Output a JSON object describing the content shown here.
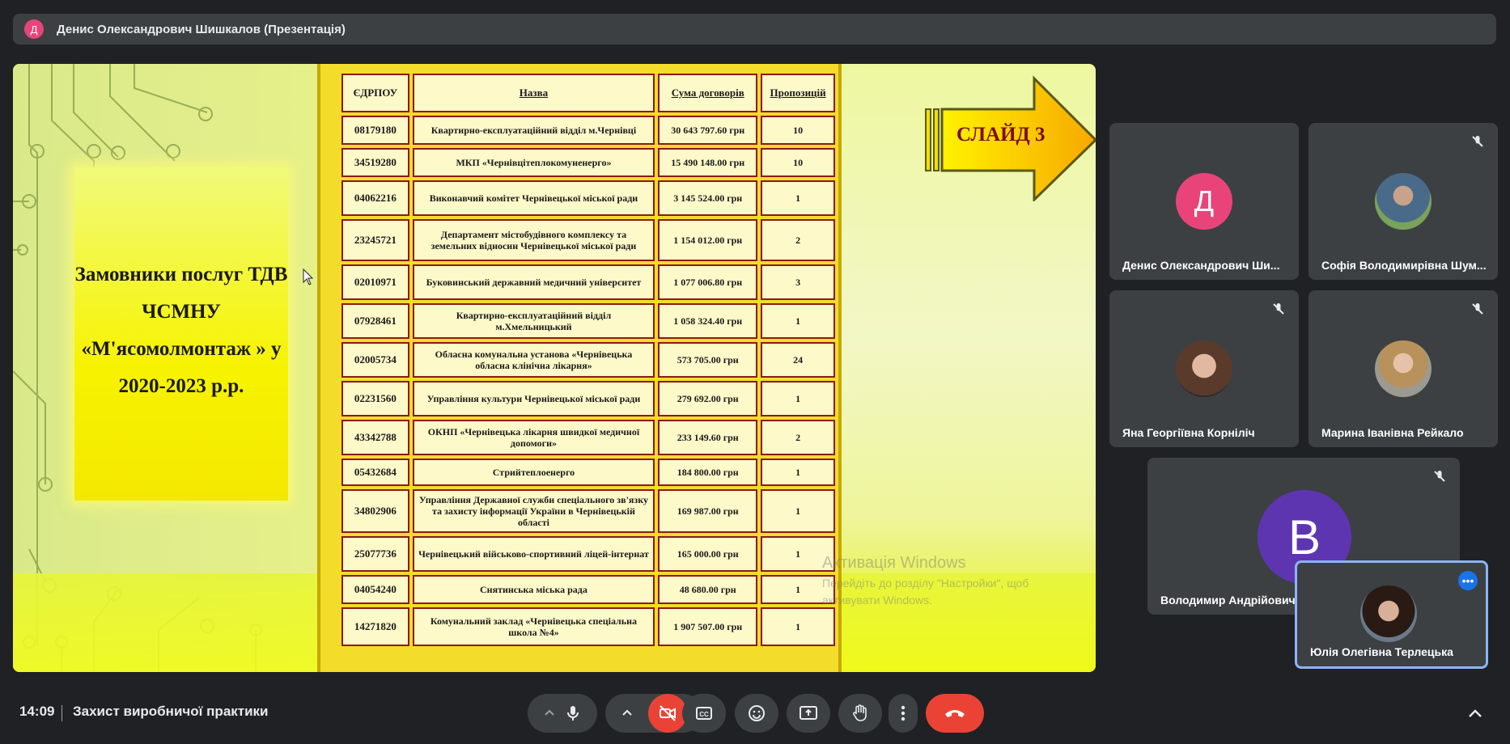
{
  "presenter_bar": {
    "avatar_letter": "Д",
    "title": "Денис Олександрович Шишкалов (Презентація)"
  },
  "slide": {
    "left_title": "Замовники послуг ТДВ ЧСМНУ «М'ясомолмонтаж » у 2020-2023 р.р.",
    "arrow_label": "СЛАЙД 3",
    "table_headers": [
      "ЄДРПОУ",
      "Назва",
      "Сума договорів",
      "Пропозицій"
    ],
    "table_rows": [
      {
        "code": "08179180",
        "name": "Квартирно-експлуатаційний відділ м.Чернівці",
        "sum": "30 643 797.60 грн",
        "offers": "10"
      },
      {
        "code": "34519280",
        "name": "МКП «Чернівцітеплокомуненерго»",
        "sum": "15 490 148.00 грн",
        "offers": "10"
      },
      {
        "code": "04062216",
        "name": "Виконавчий комітет Чернівецької міської ради",
        "sum": "3 145 524.00 грн",
        "offers": "1"
      },
      {
        "code": "23245721",
        "name": "Департамент містобудівного комплексу та земельних відносин Чернівецької міської ради",
        "sum": "1 154 012.00 грн",
        "offers": "2"
      },
      {
        "code": "02010971",
        "name": "Буковинський державний медичний університет",
        "sum": "1 077 006.80 грн",
        "offers": "3"
      },
      {
        "code": "07928461",
        "name": "Квартирно-експлуатаційний відділ м.Хмельницький",
        "sum": "1 058 324.40 грн",
        "offers": "1"
      },
      {
        "code": "02005734",
        "name": "Обласна комунальна установа «Чернівецька обласна клінічна лікарня»",
        "sum": "573 705.00 грн",
        "offers": "24"
      },
      {
        "code": "02231560",
        "name": "Управління культури Чернівецької міської ради",
        "sum": "279 692.00 грн",
        "offers": "1"
      },
      {
        "code": "43342788",
        "name": "ОКНП «Чернівецька лікарня швидкої медичної допомоги»",
        "sum": "233 149.60 грн",
        "offers": "2"
      },
      {
        "code": "05432684",
        "name": "Стрийтеплоенерго",
        "sum": "184 800.00 грн",
        "offers": "1"
      },
      {
        "code": "34802906",
        "name": "Управління Державної служби спеціального зв'язку та захисту інформації України в Чернівецькій області",
        "sum": "169 987.00 грн",
        "offers": "1"
      },
      {
        "code": "25077736",
        "name": "Чернівецький військово-спортивний ліцей-інтернат",
        "sum": "165 000.00 грн",
        "offers": "1"
      },
      {
        "code": "04054240",
        "name": "Снятинська міська рада",
        "sum": "48 680.00 грн",
        "offers": "1"
      },
      {
        "code": "14271820",
        "name": "Комунальний заклад «Чернівецька спеціальна школа №4»",
        "sum": "1 907 507.00 грн",
        "offers": "1"
      }
    ],
    "watermark_title": "Активація Windows",
    "watermark_text": "Перейдіть до розділу \"Настройки\", щоб активувати Windows."
  },
  "participants": [
    {
      "name": "Денис Олександрович Ши...",
      "avatar": "Д",
      "avatar_color": "#e8447a",
      "muted": false
    },
    {
      "name": "Софія Володимирівна Шум...",
      "avatar": "photo",
      "muted": true
    },
    {
      "name": "Яна Георгіївна Корніліч",
      "avatar": "photo",
      "muted": true
    },
    {
      "name": "Марина Іванівна Рейкало",
      "avatar": "photo",
      "muted": true
    },
    {
      "name": "Володимир Андрійович",
      "avatar": "В",
      "avatar_color": "#5e35b1",
      "muted": true
    },
    {
      "name": "Юлія Олегівна Терлецька",
      "avatar": "photo",
      "self_view": true
    }
  ],
  "bottom_bar": {
    "time": "14:09",
    "meeting_title": "Захист виробничої практики",
    "controls": [
      "mic-icon",
      "camera-off-icon",
      "captions-icon",
      "emoji-icon",
      "present-icon",
      "raise-hand-icon",
      "more-options-icon",
      "end-call-icon"
    ],
    "accent_red": "#ea4335"
  }
}
